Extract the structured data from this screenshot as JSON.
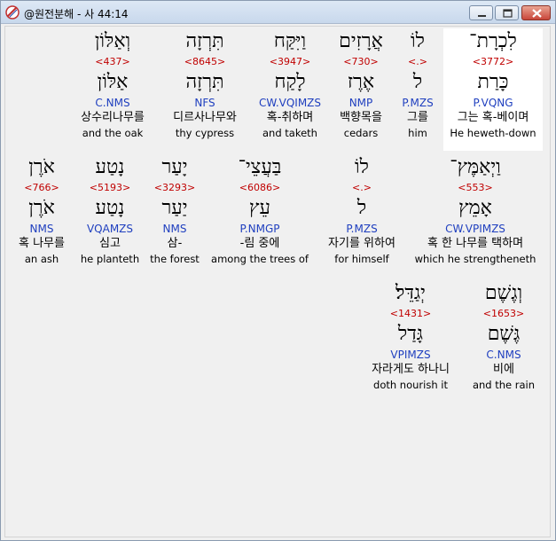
{
  "window": {
    "title": "@원전분해 - 사 44:14",
    "buttons": {
      "minimize": "minimize",
      "maximize": "maximize",
      "close": "close"
    }
  },
  "rows": [
    [
      {
        "heb": "לִכְרָת־",
        "strong": "<3772>",
        "lemma": "כָּרַת",
        "morph": "P.VQNG",
        "kor": "그는 혹-베이며",
        "eng": "He heweth-down",
        "selected": true
      },
      {
        "heb": "לוֹ",
        "strong": "<.>",
        "lemma": "ל",
        "morph": "P.MZS",
        "kor": "그를",
        "eng": "him"
      },
      {
        "heb": "אֲרָזִים",
        "strong": "<730>",
        "lemma": "אֶרֶז",
        "morph": "NMP",
        "kor": "백향목을",
        "eng": "cedars"
      },
      {
        "heb": "וַיִּקַּח",
        "strong": "<3947>",
        "lemma": "לָקַח",
        "morph": "CW.VQIMZS",
        "kor": "혹-취하며",
        "eng": "and taketh"
      },
      {
        "heb": "תִּרְזָה",
        "strong": "<8645>",
        "lemma": "תִּרְזָה",
        "morph": "NFS",
        "kor": "디르사나무와",
        "eng": "thy cypress"
      },
      {
        "heb": "וְאַלּוֹן",
        "strong": "<437>",
        "lemma": "אַלּוֹן",
        "morph": "C.NMS",
        "kor": "상수리나무를",
        "eng": "and the oak"
      }
    ],
    [
      {
        "heb": "וַיְאַמֶּץ־",
        "strong": "<553>",
        "lemma": "אָמֵץ",
        "morph": "CW.VPIMZS",
        "kor": "혹 한 나무를 택하며",
        "eng": "which he strengtheneth"
      },
      {
        "heb": "לוֹ",
        "strong": "<.>",
        "lemma": "ל",
        "morph": "P.MZS",
        "kor": "자기를 위하여",
        "eng": "for himself"
      },
      {
        "heb": "בַּעֲצֵי־",
        "strong": "<6086>",
        "lemma": "עֵץ",
        "morph": "P.NMGP",
        "kor": "-림 중에",
        "eng": "among the trees of"
      },
      {
        "heb": "יָעַר",
        "strong": "<3293>",
        "lemma": "יַעַר",
        "morph": "NMS",
        "kor": "삼-",
        "eng": "the forest"
      },
      {
        "heb": "נָטַע",
        "strong": "<5193>",
        "lemma": "נָטַע",
        "morph": "VQAMZS",
        "kor": "심고",
        "eng": "he planteth"
      },
      {
        "heb": "אֹרֶן",
        "strong": "<766>",
        "lemma": "אֹרֶן",
        "morph": "NMS",
        "kor": "혹 나무를",
        "eng": "an ash"
      }
    ],
    [
      {
        "heb": "וְגֶשֶׁם",
        "strong": "<1653>",
        "lemma": "גֶּשֶׁם",
        "morph": "C.NMS",
        "kor": "비에",
        "eng": "and the rain"
      },
      {
        "heb": "יְגַדֵּל׃",
        "strong": "<1431>",
        "lemma": "גָּדַל",
        "morph": "VPIMZS",
        "kor": "자라게도 하나니",
        "eng": "doth nourish it"
      }
    ]
  ]
}
